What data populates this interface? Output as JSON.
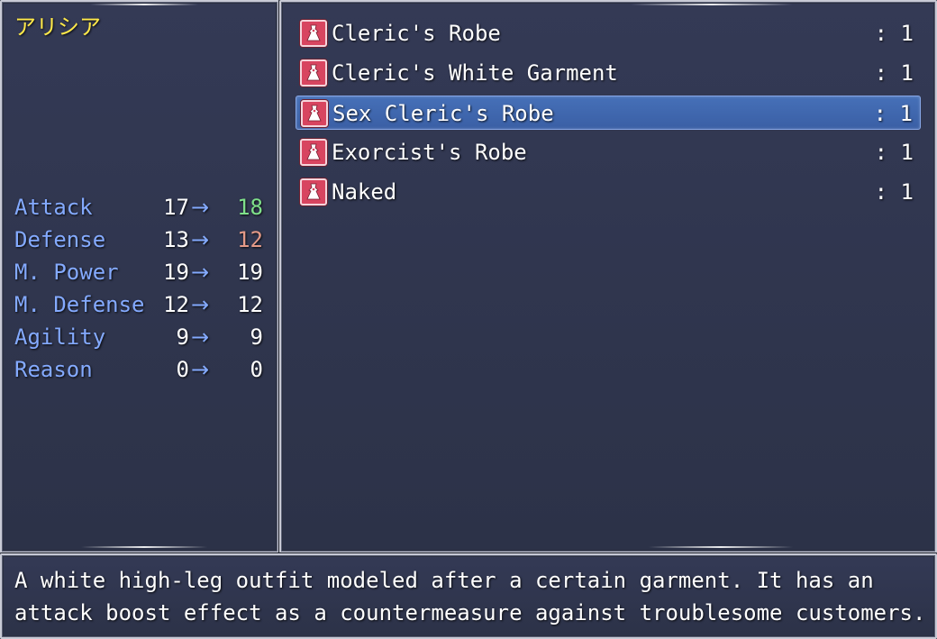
{
  "actor": {
    "name": "アリシア"
  },
  "params": [
    {
      "label": "Attack",
      "old": "17",
      "new": "18",
      "change": "up"
    },
    {
      "label": "Defense",
      "old": "13",
      "new": "12",
      "change": "down"
    },
    {
      "label": "M. Power",
      "old": "19",
      "new": "19",
      "change": "same"
    },
    {
      "label": "M. Defense",
      "old": "12",
      "new": "12",
      "change": "same"
    },
    {
      "label": "Agility",
      "old": "9",
      "new": "9",
      "change": "same"
    },
    {
      "label": "Reason",
      "old": "0",
      "new": "0",
      "change": "same"
    }
  ],
  "arrow_glyph": "→",
  "items": [
    {
      "name": "Cleric's Robe",
      "count": ": 1",
      "icon": "dress-icon",
      "selected": false
    },
    {
      "name": "Cleric's White Garment",
      "count": ": 1",
      "icon": "dress-icon",
      "selected": false
    },
    {
      "name": "Sex Cleric's Robe",
      "count": ": 1",
      "icon": "dress-icon",
      "selected": true
    },
    {
      "name": "Exorcist's Robe",
      "count": ": 1",
      "icon": "dress-icon",
      "selected": false
    },
    {
      "name": "Naked",
      "count": ": 1",
      "icon": "dress-icon",
      "selected": false
    }
  ],
  "help": {
    "line1": "A white high-leg outfit modeled after a certain garment. It has an",
    "line2": "attack boost effect as a countermeasure against troublesome customers."
  },
  "colors": {
    "system_text": "#84aaff",
    "actor_name": "#ffe94a",
    "power_up": "#7fe08a",
    "power_down": "#e49a88",
    "icon_bg": "#d84560",
    "cursor": "#4670b8"
  }
}
